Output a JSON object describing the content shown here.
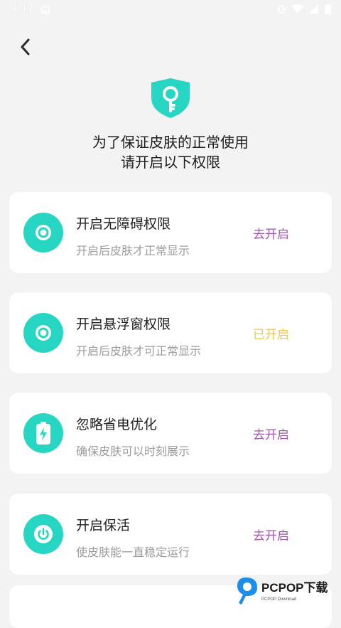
{
  "status_bar": {
    "time": "4:17"
  },
  "header": {
    "back_icon": "chevron-left-icon",
    "line1": "为了保证皮肤的正常使用",
    "line2": "请开启以下权限"
  },
  "permissions": [
    {
      "title": "开启无障碍权限",
      "description": "开启后皮肤才正常显示",
      "action": "去开启",
      "icon": "circle-dot-icon",
      "state": "pending"
    },
    {
      "title": "开启悬浮窗权限",
      "description": "开启后皮肤才可正常显示",
      "action": "已开启",
      "icon": "circle-dot-icon",
      "state": "enabled"
    },
    {
      "title": "忽略省电优化",
      "description": "确保皮肤可以时刻展示",
      "action": "去开启",
      "icon": "battery-icon",
      "state": "pending"
    },
    {
      "title": "开启保活",
      "description": "使皮肤能一直稳定运行",
      "action": "去开启",
      "icon": "power-icon",
      "state": "pending"
    }
  ],
  "colors": {
    "accent_teal": "#27d6c2",
    "action_pending": "#9b59a8",
    "action_enabled": "#f2c645"
  },
  "watermark": {
    "text": "PCPOP下载",
    "subtext": "PCPOP Download"
  }
}
